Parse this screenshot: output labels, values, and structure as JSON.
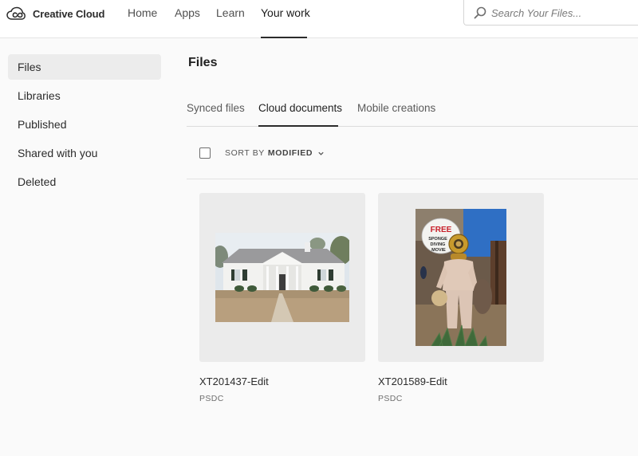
{
  "app": {
    "name": "Creative Cloud"
  },
  "nav": {
    "items": [
      {
        "label": "Home"
      },
      {
        "label": "Apps"
      },
      {
        "label": "Learn"
      },
      {
        "label": "Your work"
      }
    ],
    "active": "Your work"
  },
  "search": {
    "placeholder": "Search Your Files..."
  },
  "sidebar": {
    "items": [
      {
        "label": "Files"
      },
      {
        "label": "Libraries"
      },
      {
        "label": "Published"
      },
      {
        "label": "Shared with you"
      },
      {
        "label": "Deleted"
      }
    ],
    "active": "Files"
  },
  "main": {
    "title": "Files",
    "tabs": [
      {
        "label": "Synced files"
      },
      {
        "label": "Cloud documents"
      },
      {
        "label": "Mobile creations"
      }
    ],
    "active_tab": "Cloud documents",
    "sort": {
      "label": "SORT BY",
      "value": "MODIFIED"
    },
    "files": [
      {
        "name": "XT201437-Edit",
        "type": "PSDC"
      },
      {
        "name": "XT201589-Edit",
        "type": "PSDC"
      }
    ],
    "sign_text": [
      "FREE",
      "SPONGE",
      "DIVING",
      "MOVIE"
    ]
  },
  "colors": {
    "active_bg": "#ececec",
    "underline": "#2c2c2c",
    "card_bg": "#ebebeb"
  }
}
